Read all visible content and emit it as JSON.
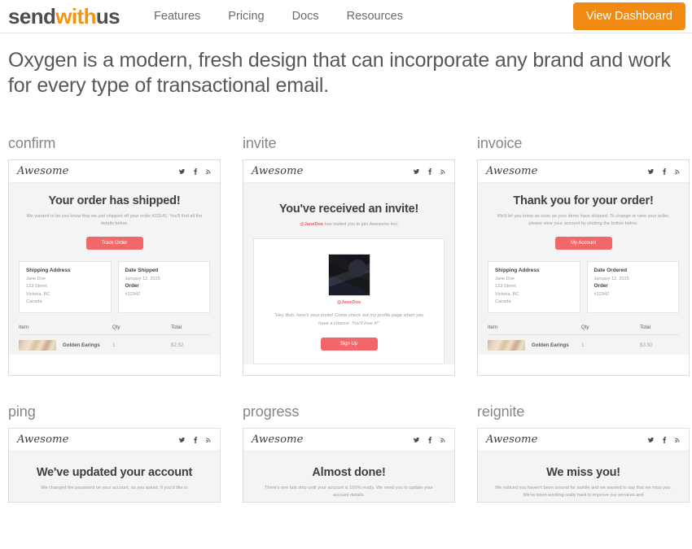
{
  "nav": {
    "logo_part1": "send",
    "logo_accent": "with",
    "logo_part2": "us",
    "links": [
      {
        "label": "Features"
      },
      {
        "label": "Pricing"
      },
      {
        "label": "Docs"
      },
      {
        "label": "Resources"
      }
    ],
    "cta_label": "View Dashboard",
    "cta_color": "#f08a12"
  },
  "headline": "Oxygen is a modern, fresh design that can incorporate any brand and work for every type of transactional email.",
  "email_brand": "Awesome",
  "social_icons": [
    "twitter-icon",
    "facebook-icon",
    "rss-icon"
  ],
  "accent_color": "#f2686a",
  "cards": {
    "confirm": {
      "title": "confirm",
      "heading": "Your order has shipped!",
      "body": "We wanted to let you know that we just shipped off your order #23141. You'll find all the details below.",
      "button": "Track Order",
      "box_left_heading": "Shipping Address",
      "box_left_lines": [
        "Jane Doe",
        "123 Street",
        "Victoria, BC",
        "Canada"
      ],
      "box_right_heading_1": "Date Shipped",
      "box_right_value_1": "January 12, 2015",
      "box_right_heading_2": "Order",
      "box_right_value_2": "#12342",
      "table_headers": [
        "Item",
        "Qty",
        "Total"
      ],
      "table_row": {
        "item": "Golden Earings",
        "qty": "1",
        "total": "$2.52"
      }
    },
    "invite": {
      "title": "invite",
      "heading": "You've received an invite!",
      "body_highlight": "@JaneDoe",
      "body_rest": " has invited you to join Awesome Inc!",
      "avatar_name": "@JaneDoe",
      "quote": "\"Hey Bob, here's your invite! Come check out my profile page when you have a chance. You'll love it!\"",
      "button": "Sign Up"
    },
    "invoice": {
      "title": "invoice",
      "heading": "Thank you for your order!",
      "body": "We'll let you know as soon as your items have shipped. To change or view your order, please view your account by clicking the button below.",
      "button": "My Account",
      "box_left_heading": "Shipping Address",
      "box_left_lines": [
        "Jane Doe",
        "123 Street",
        "Victoria, BC",
        "Canada"
      ],
      "box_right_heading_1": "Date Ordered",
      "box_right_value_1": "January 12, 2015",
      "box_right_heading_2": "Order",
      "box_right_value_2": "#12342",
      "table_headers": [
        "Item",
        "Qty",
        "Total"
      ],
      "table_row": {
        "item": "Golden Earings",
        "qty": "1",
        "total": "$3.50"
      }
    },
    "ping": {
      "title": "ping",
      "heading": "We've updated your account",
      "body": "We changed the password on your account, as you asked. If you'd like to"
    },
    "progress": {
      "title": "progress",
      "heading": "Almost done!",
      "body": "There's one last step until your account is 100% ready. We need you to update your account details."
    },
    "reignite": {
      "title": "reignite",
      "heading": "We miss you!",
      "body": "We noticed you haven't been around for awhile and we wanted to say that we miss you. We've been working really hard to improve our services and"
    }
  }
}
